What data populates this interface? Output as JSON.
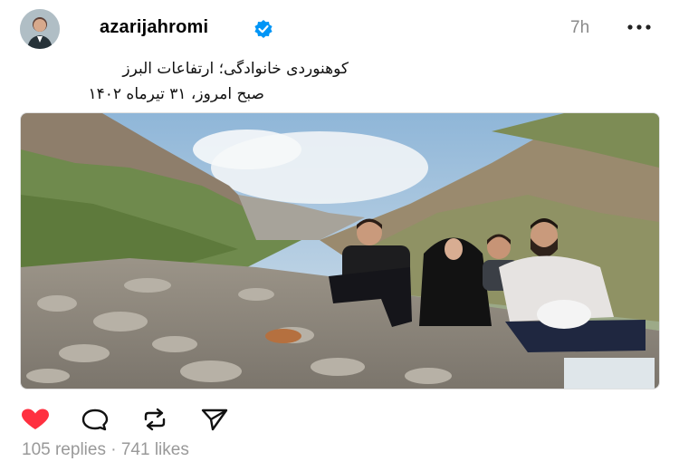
{
  "post": {
    "username": "azarijahromi",
    "time": "7h",
    "caption_line1": "کوهنوردی خانوادگی؛ ارتفاعات البرز",
    "caption_line2": "صبح امروز، ۳۱ تیرماه ۱۴۰۲",
    "replies_count": "105 replies",
    "separator": " · ",
    "likes_count": "741 likes"
  },
  "icons": {
    "verified": "verified-badge-icon",
    "more": "more-horizontal-icon",
    "like": "heart-icon",
    "reply": "comment-bubble-icon",
    "repost": "repost-icon",
    "share": "send-icon"
  },
  "colors": {
    "accent_like": "#ff3040",
    "verified_blue": "#0095f6",
    "muted_text": "#999999"
  }
}
